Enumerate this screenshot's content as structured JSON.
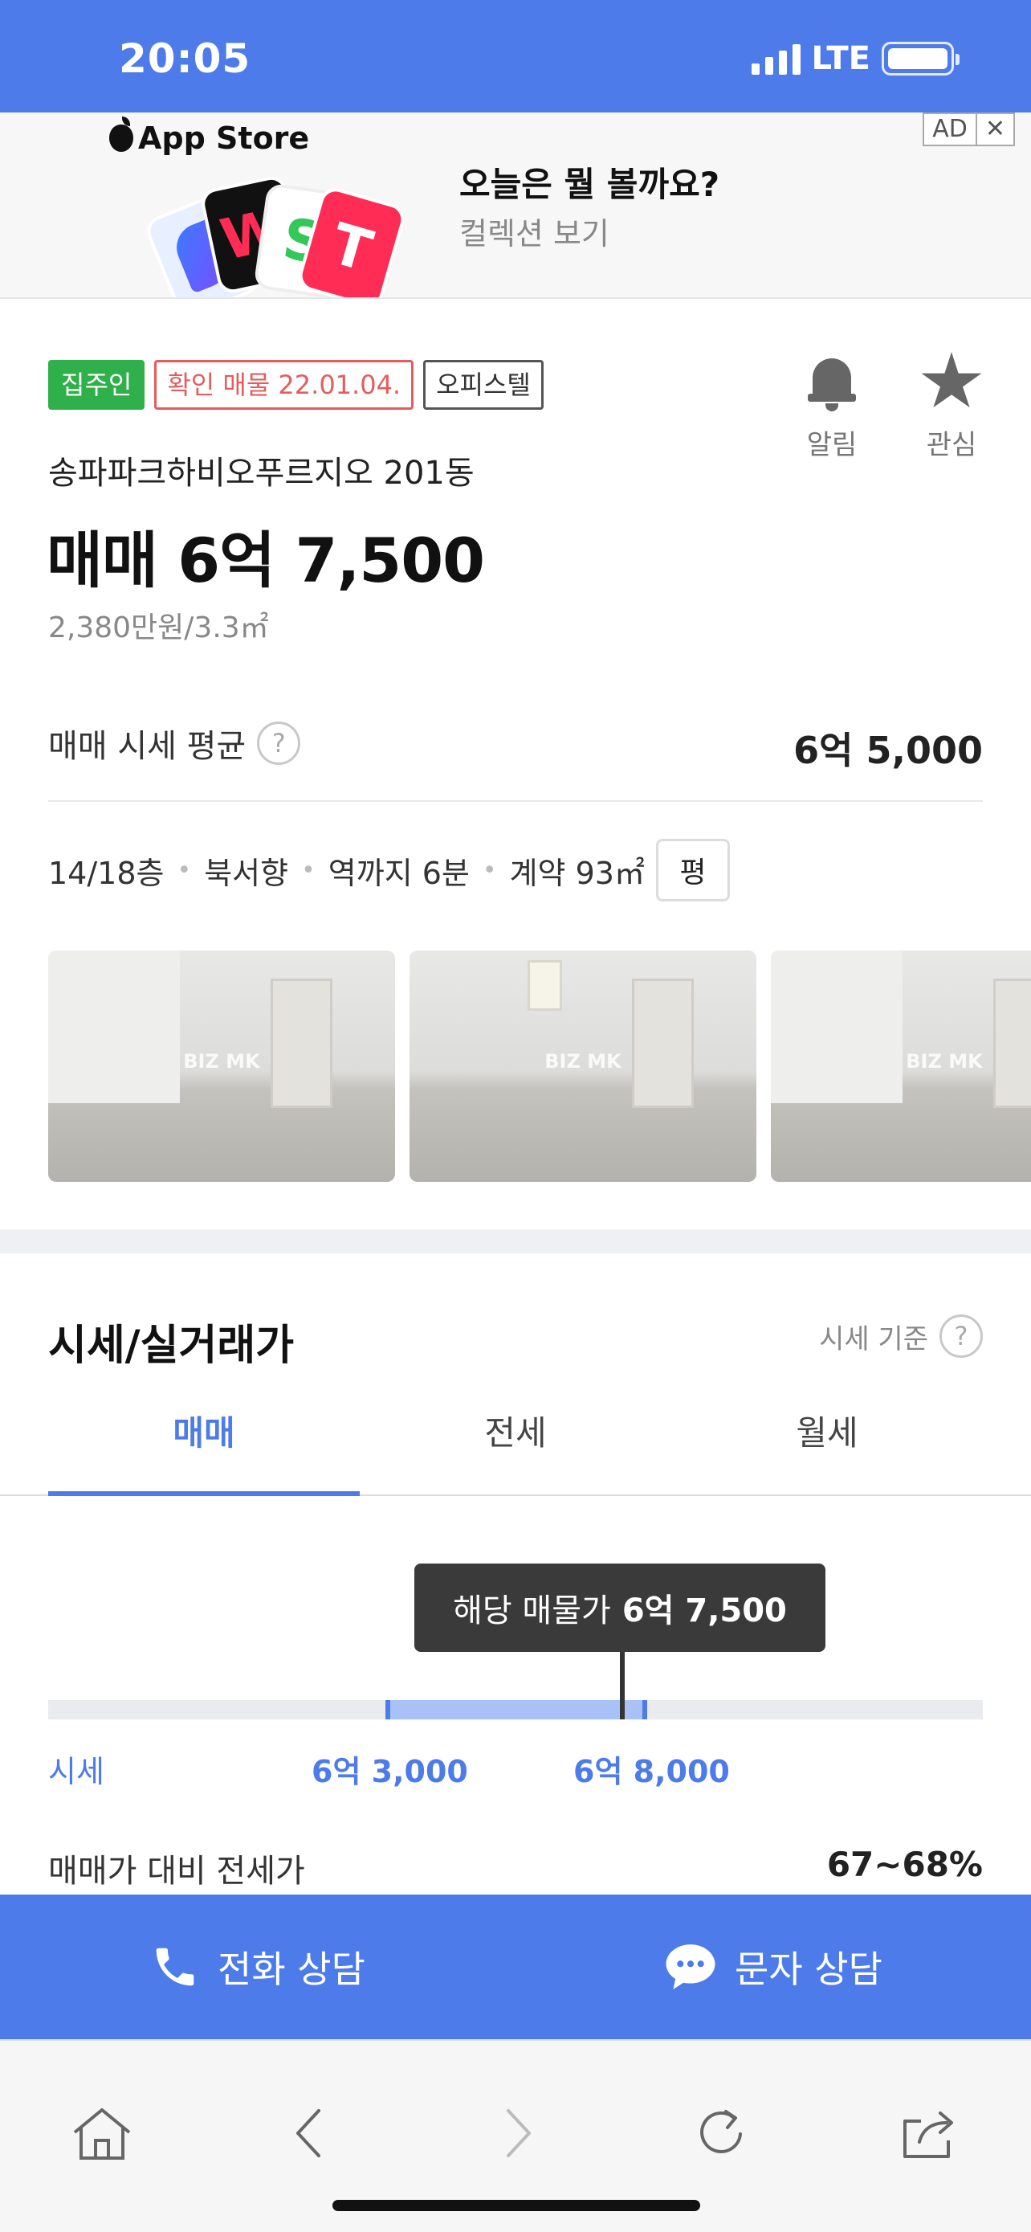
{
  "status_bar": {
    "time": "20:05",
    "network": "LTE"
  },
  "ad": {
    "store": "App Store",
    "title": "오늘은 뭘 볼까요?",
    "subtitle": "컬렉션 보기",
    "ad_label": "AD",
    "close_label": "✕"
  },
  "listing": {
    "tags": [
      "집주인",
      "확인 매물 22.01.04.",
      "오피스텔"
    ],
    "building": "송파파크하비오푸르지오 201동",
    "price": "매매 6억 7,500",
    "unit_price": "2,380만원/3.3㎡",
    "actions": {
      "alert": "알림",
      "favorite": "관심"
    },
    "avg_label": "매매 시세 평균",
    "avg_value": "6억 5,000",
    "specs": [
      "14/18층",
      "북서향",
      "역까지 6분",
      "계약 93㎡"
    ],
    "unit_toggle": "평",
    "photo_watermark": "BIZ MK"
  },
  "market": {
    "title": "시세/실거래가",
    "basis": "시세 기준",
    "tabs": [
      "매매",
      "전세",
      "월세"
    ],
    "active_tab": "매매",
    "tooltip_label": "해당 매물가",
    "tooltip_value": "6억 7,500",
    "range_label": "시세",
    "range_low": "6억 3,000",
    "range_high": "6억 8,000",
    "ratio_label": "매매가 대비 전세가",
    "ratio_value": "67~68%"
  },
  "cta": {
    "call": "전화 상담",
    "message": "문자 상담"
  },
  "colors": {
    "brand_blue": "#4d7bea",
    "owner_green": "#2fb04a",
    "confirm_red": "#e45d5d"
  },
  "browser_nav": [
    "home-icon",
    "back-icon",
    "forward-icon",
    "reload-icon",
    "share-icon"
  ]
}
